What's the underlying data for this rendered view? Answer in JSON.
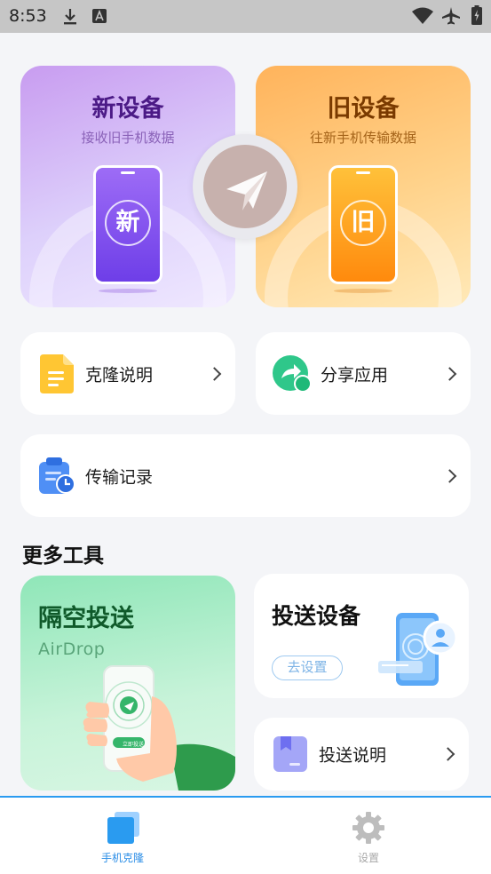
{
  "status_bar": {
    "time": "8:53"
  },
  "hero": {
    "new_device": {
      "title": "新设备",
      "subtitle": "接收旧手机数据",
      "badge": "新"
    },
    "old_device": {
      "title": "旧设备",
      "subtitle": "往新手机传输数据",
      "badge": "旧"
    }
  },
  "menu": {
    "clone_guide": "克隆说明",
    "share_app": "分享应用",
    "transfer_history": "传输记录"
  },
  "more_tools": {
    "section_title": "更多工具",
    "airdrop": {
      "title": "隔空投送",
      "subtitle": "AirDrop",
      "phone_button": "立即投送"
    },
    "cast_device": {
      "title": "投送设备",
      "button": "去设置"
    },
    "cast_guide": "投送说明"
  },
  "tabbar": {
    "tabs": [
      {
        "label": "手机克隆",
        "active": true
      },
      {
        "label": "设置",
        "active": false
      }
    ]
  },
  "colors": {
    "accent": "#2a9bf0",
    "new_card": "#c89cf0",
    "old_card": "#ffb35b",
    "airdrop_card": "#8fe6b8"
  }
}
